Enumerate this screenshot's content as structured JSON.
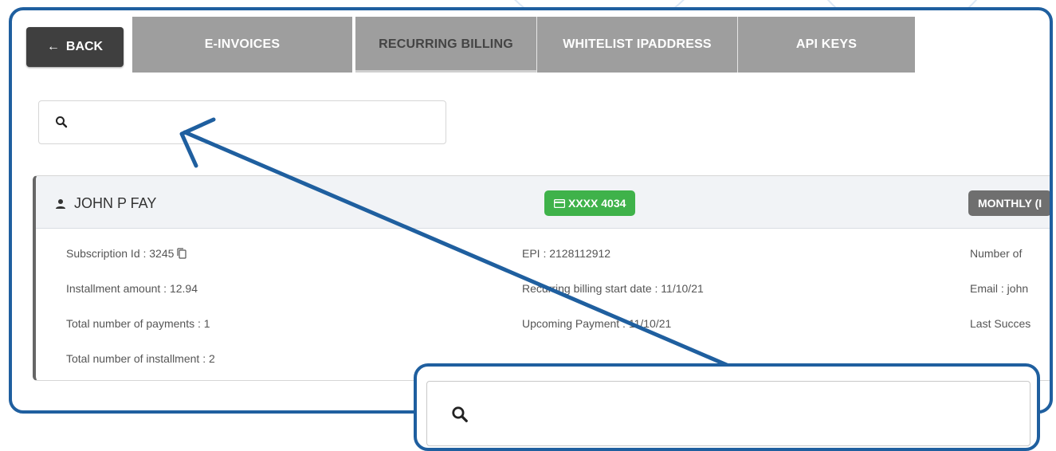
{
  "nav": {
    "back_label": "BACK",
    "tabs": [
      {
        "label": "E-INVOICES"
      },
      {
        "label": "RECURRING BILLING"
      },
      {
        "label": "WHITELIST IPADDRESS"
      },
      {
        "label": "API KEYS"
      }
    ]
  },
  "search": {
    "placeholder": ""
  },
  "subscription": {
    "customer_name": "JOHN P FAY",
    "card_badge": "XXXX 4034",
    "frequency_badge": "MONTHLY (I",
    "details": {
      "subscription_id": "Subscription Id : 3245",
      "installment_amount": "Installment amount : 12.94",
      "total_payments": "Total number of payments : 1",
      "total_installments": "Total number of installment : 2",
      "epi": "EPI : 2128112912",
      "start_date": "Recurring billing start date : 11/10/21",
      "upcoming_payment": "Upcoming Payment : 11/10/21",
      "number_of": "Number of",
      "email": "Email : john",
      "last_success": "Last Succes"
    }
  },
  "overlay": {
    "search_placeholder": ""
  },
  "colors": {
    "frame_blue": "#1f5f9f",
    "card_badge_green": "#3fb24a",
    "tab_gray": "#9e9e9e",
    "back_dark": "#3f3f3f"
  }
}
